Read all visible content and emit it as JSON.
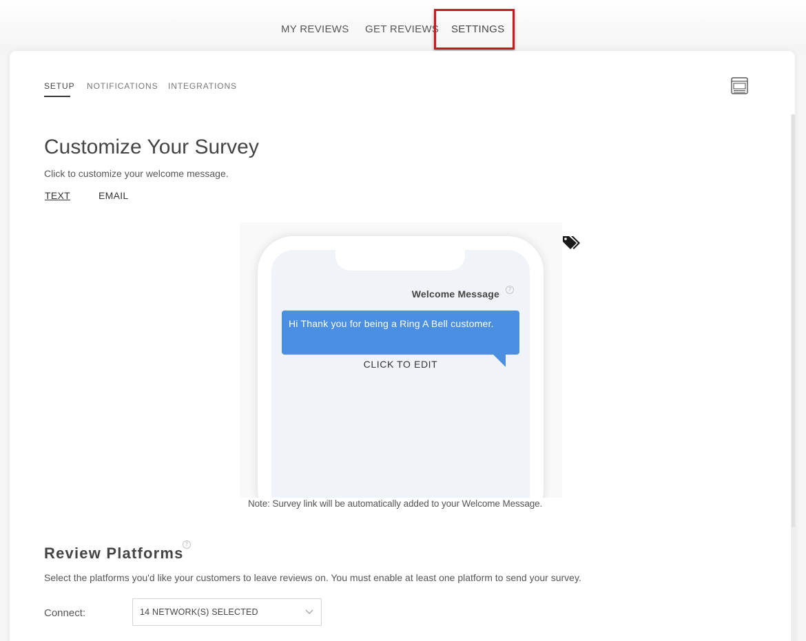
{
  "top_nav": {
    "items": [
      {
        "label": "MY REVIEWS"
      },
      {
        "label": "GET REVIEWS"
      },
      {
        "label": "SETTINGS"
      }
    ],
    "active": "SETTINGS"
  },
  "sub_tabs": {
    "items": [
      {
        "label": "SETUP"
      },
      {
        "label": "NOTIFICATIONS"
      },
      {
        "label": "INTEGRATIONS"
      }
    ],
    "active": "SETUP",
    "right_icon": "layout-preview-icon"
  },
  "survey": {
    "title": "Customize Your Survey",
    "subtitle": "Click to customize your welcome message.",
    "message_tabs": [
      {
        "label": "TEXT"
      },
      {
        "label": "EMAIL"
      }
    ],
    "active_message_tab": "TEXT",
    "phone": {
      "welcome_label": "Welcome Message",
      "help_icon": "?",
      "bubble_text": "Hi Thank you for being a Ring A Bell customer.",
      "edit_label": "CLICK TO EDIT"
    },
    "tag_icon": "tags-icon",
    "note": "Note: Survey link will be automatically added to your Welcome Message."
  },
  "platforms": {
    "title": "Review Platforms",
    "help_icon": "?",
    "description": "Select the platforms you'd like your customers to leave reviews on. You must enable at least one platform to send your survey.",
    "connect_label": "Connect:",
    "select_value": "14 NETWORK(S) SELECTED"
  },
  "colors": {
    "bubble": "#4a8fe1",
    "highlight": "#d0161b",
    "screen": "#f0f4f9"
  }
}
